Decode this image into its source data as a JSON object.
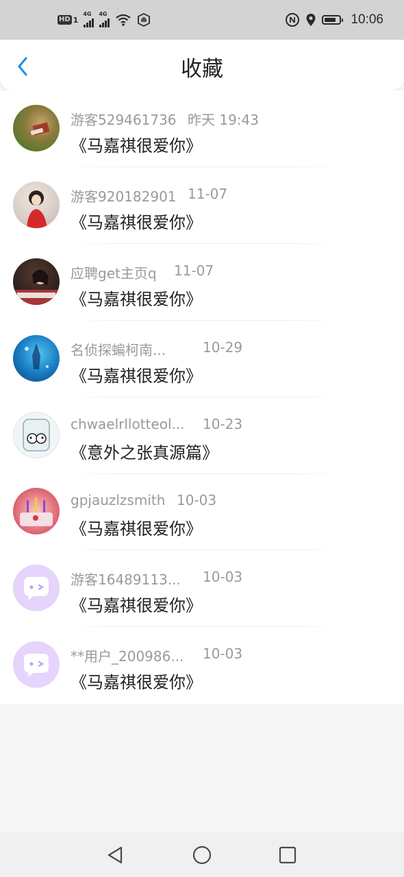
{
  "status_bar": {
    "hd_badge": "HD",
    "sim1": "1",
    "net1": "4G",
    "net2": "4G",
    "time": "10:06",
    "icons": [
      "signal-icon",
      "wifi-icon",
      "hand-icon",
      "nfc-icon",
      "location-icon",
      "battery-icon"
    ]
  },
  "header": {
    "title": "收藏",
    "back_icon": "chevron-left-icon"
  },
  "colors": {
    "accent": "#1b8fe6",
    "placeholder_avatar": "#e5d4fb",
    "placeholder_face": "#bda4f0"
  },
  "items": [
    {
      "user": "游客529461736",
      "date": "昨天 19:43",
      "title": "《马嘉祺很爱你》"
    },
    {
      "user": "游客920182901",
      "date": "11-07",
      "title": "《马嘉祺很爱你》"
    },
    {
      "user": "应聘get主页q",
      "date": "11-07",
      "title": "《马嘉祺很爱你》"
    },
    {
      "user": "名侦探蝙柯南...",
      "date": "10-29",
      "title": "《马嘉祺很爱你》"
    },
    {
      "user": "chwaelrllotteol...",
      "date": "10-23",
      "title": "《意外之张真源篇》"
    },
    {
      "user": "gpjauzlzsmith",
      "date": "10-03",
      "title": "《马嘉祺很爱你》"
    },
    {
      "user": "游客16489113...",
      "date": "10-03",
      "title": "《马嘉祺很爱你》"
    },
    {
      "user": "**用户_200986...",
      "date": "10-03",
      "title": "《马嘉祺很爱你》"
    }
  ],
  "nav_bar": {
    "back": "triangle-back-icon",
    "home": "circle-home-icon",
    "recents": "square-recents-icon"
  }
}
